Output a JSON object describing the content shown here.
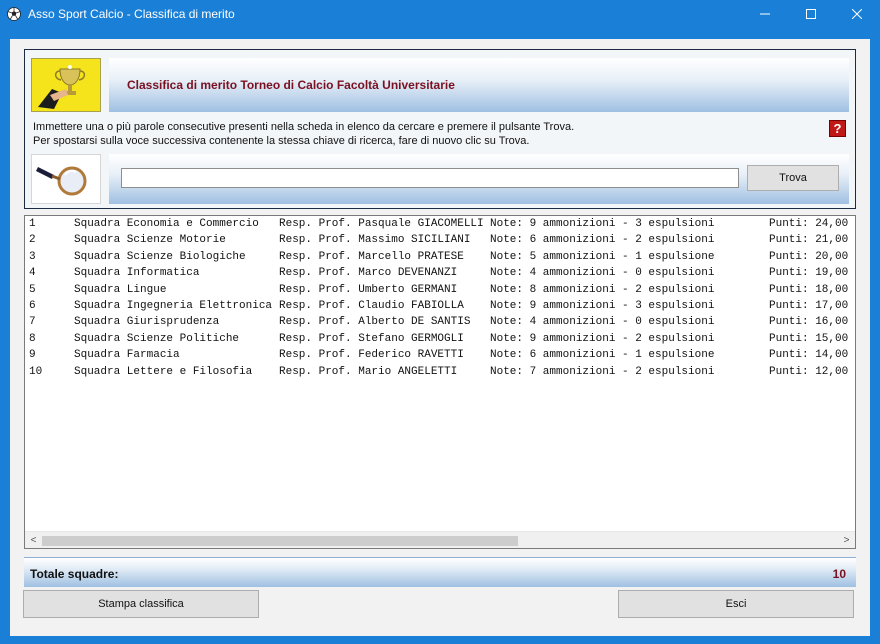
{
  "window": {
    "title": "Asso Sport Calcio - Classifica di merito",
    "controls": {
      "minimize": "─",
      "maximize": "☐",
      "close": "✕"
    }
  },
  "header": {
    "title": "Classifica di merito Torneo di Calcio Facoltà Universitarie",
    "help_label": "?"
  },
  "instructions": {
    "line1": "Immettere una o più parole consecutive presenti nella scheda in elenco da cercare e premere il pulsante Trova.",
    "line2": "Per spostarsi sulla voce successiva contenente la stessa chiave di ricerca, fare di nuovo clic su Trova."
  },
  "search": {
    "value": "",
    "button_label": "Trova"
  },
  "list": {
    "rows": [
      {
        "num": "1",
        "team": "Squadra Economia e Commercio",
        "resp": "Resp. Prof. Pasquale GIACOMELLI",
        "note": "Note: 9 ammonizioni - 3 espulsioni",
        "points": "Punti: 24,00"
      },
      {
        "num": "2",
        "team": "Squadra Scienze Motorie",
        "resp": "Resp. Prof. Massimo SICILIANI",
        "note": "Note: 6 ammonizioni - 2 espulsioni",
        "points": "Punti: 21,00"
      },
      {
        "num": "3",
        "team": "Squadra Scienze Biologiche",
        "resp": "Resp. Prof. Marcello PRATESE",
        "note": "Note: 5 ammonizioni - 1 espulsione",
        "points": "Punti: 20,00"
      },
      {
        "num": "4",
        "team": "Squadra Informatica",
        "resp": "Resp. Prof. Marco DEVENANZI",
        "note": "Note: 4 ammonizioni - 0 espulsioni",
        "points": "Punti: 19,00"
      },
      {
        "num": "5",
        "team": "Squadra Lingue",
        "resp": "Resp. Prof. Umberto GERMANI",
        "note": "Note: 8 ammonizioni - 2 espulsioni",
        "points": "Punti: 18,00"
      },
      {
        "num": "6",
        "team": "Squadra Ingegneria Elettronica",
        "resp": "Resp. Prof. Claudio FABIOLLA",
        "note": "Note: 9 ammonizioni - 3 espulsioni",
        "points": "Punti: 17,00"
      },
      {
        "num": "7",
        "team": "Squadra Giurisprudenza",
        "resp": "Resp. Prof. Alberto DE SANTIS",
        "note": "Note: 4 ammonizioni - 0 espulsioni",
        "points": "Punti: 16,00"
      },
      {
        "num": "8",
        "team": "Squadra Scienze Politiche",
        "resp": "Resp. Prof. Stefano GERMOGLI",
        "note": "Note: 9 ammonizioni - 2 espulsioni",
        "points": "Punti: 15,00"
      },
      {
        "num": "9",
        "team": "Squadra Farmacia",
        "resp": "Resp. Prof. Federico RAVETTI",
        "note": "Note: 6 ammonizioni - 1 espulsione",
        "points": "Punti: 14,00"
      },
      {
        "num": "10",
        "team": "Squadra Lettere e Filosofia",
        "resp": "Resp. Prof. Mario ANGELETTI",
        "note": "Note: 7 ammonizioni - 2 espulsioni",
        "points": "Punti: 12,00"
      }
    ],
    "scroll_left": "<",
    "scroll_right": ">"
  },
  "totals": {
    "label": "Totale squadre:",
    "value": "10"
  },
  "buttons": {
    "print_label": "Stampa classifica",
    "exit_label": "Esci"
  },
  "colors": {
    "titlebar": "#1a7fd6",
    "accent_text": "#7a1020",
    "help": "#c01717"
  },
  "icons": {
    "app": "soccer-ball-icon",
    "header_image": "trophy-icon",
    "search_image": "magnifier-icon"
  }
}
